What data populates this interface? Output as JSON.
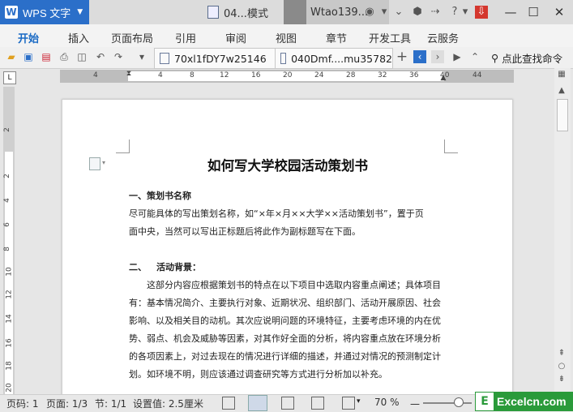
{
  "app": {
    "name": "WPS 文字"
  },
  "tabs": {
    "doc1": "04...模式",
    "doc2": "Wtao139..."
  },
  "ribbon": [
    "开始",
    "插入",
    "页面布局",
    "引用",
    "审阅",
    "视图",
    "章节",
    "开发工具",
    "云服务"
  ],
  "toolbar": {
    "doc_tab_1": "70xl1fDY7w25146",
    "doc_tab_2": "040Dmf....mu35782",
    "search_label": "点此查找命令"
  },
  "ruler": {
    "h": [
      "4",
      "4",
      "8",
      "12",
      "16",
      "20",
      "24",
      "28",
      "32",
      "36",
      "40",
      "44"
    ],
    "v": [
      "2",
      "2",
      "4",
      "6",
      "8",
      "10",
      "12",
      "14",
      "16",
      "18",
      "20"
    ]
  },
  "document": {
    "title": "如何写大学校园活动策划书",
    "heading1": "一、策划书名称",
    "p1_l1": "尽可能具体的写出策划名称，如“×年×月××大学××活动策划书”，置于页",
    "p1_l2": "面中央，当然可以写出正标题后将此作为副标题写在下面。",
    "heading2_num": "二、",
    "heading2_text": "活动背景：",
    "p2_l1": "这部分内容应根据策划书的特点在以下项目中选取内容重点阐述；具体项目",
    "p2_l2": "有：基本情况简介、主要执行对象、近期状况、组织部门、活动开展原因、社会",
    "p2_l3": "影响、以及相关目的动机。其次应说明问题的环境特征，主要考虑环境的内在优",
    "p2_l4": "势、弱点、机会及威胁等因素，对其作好全面的分析，将内容重点放在环境分析",
    "p2_l5": "的各项因素上，对过去现在的情况进行详细的描述，并通过对情况的预测制定计",
    "p2_l6": "划。如环境不明，则应该通过调查研究等方式进行分析加以补充。"
  },
  "status": {
    "page_no": "页码: 1",
    "pages": "页面: 1/3",
    "section": "节: 1/1",
    "setting": "设置值: 2.5厘米",
    "zoom": "70 %"
  },
  "watermark": {
    "logo": "E",
    "text": "Excelcn.com"
  },
  "colors": {
    "brand": "#2b6fc9",
    "active_tab": "#1a6ac4",
    "watermark": "#2a9a3a"
  }
}
